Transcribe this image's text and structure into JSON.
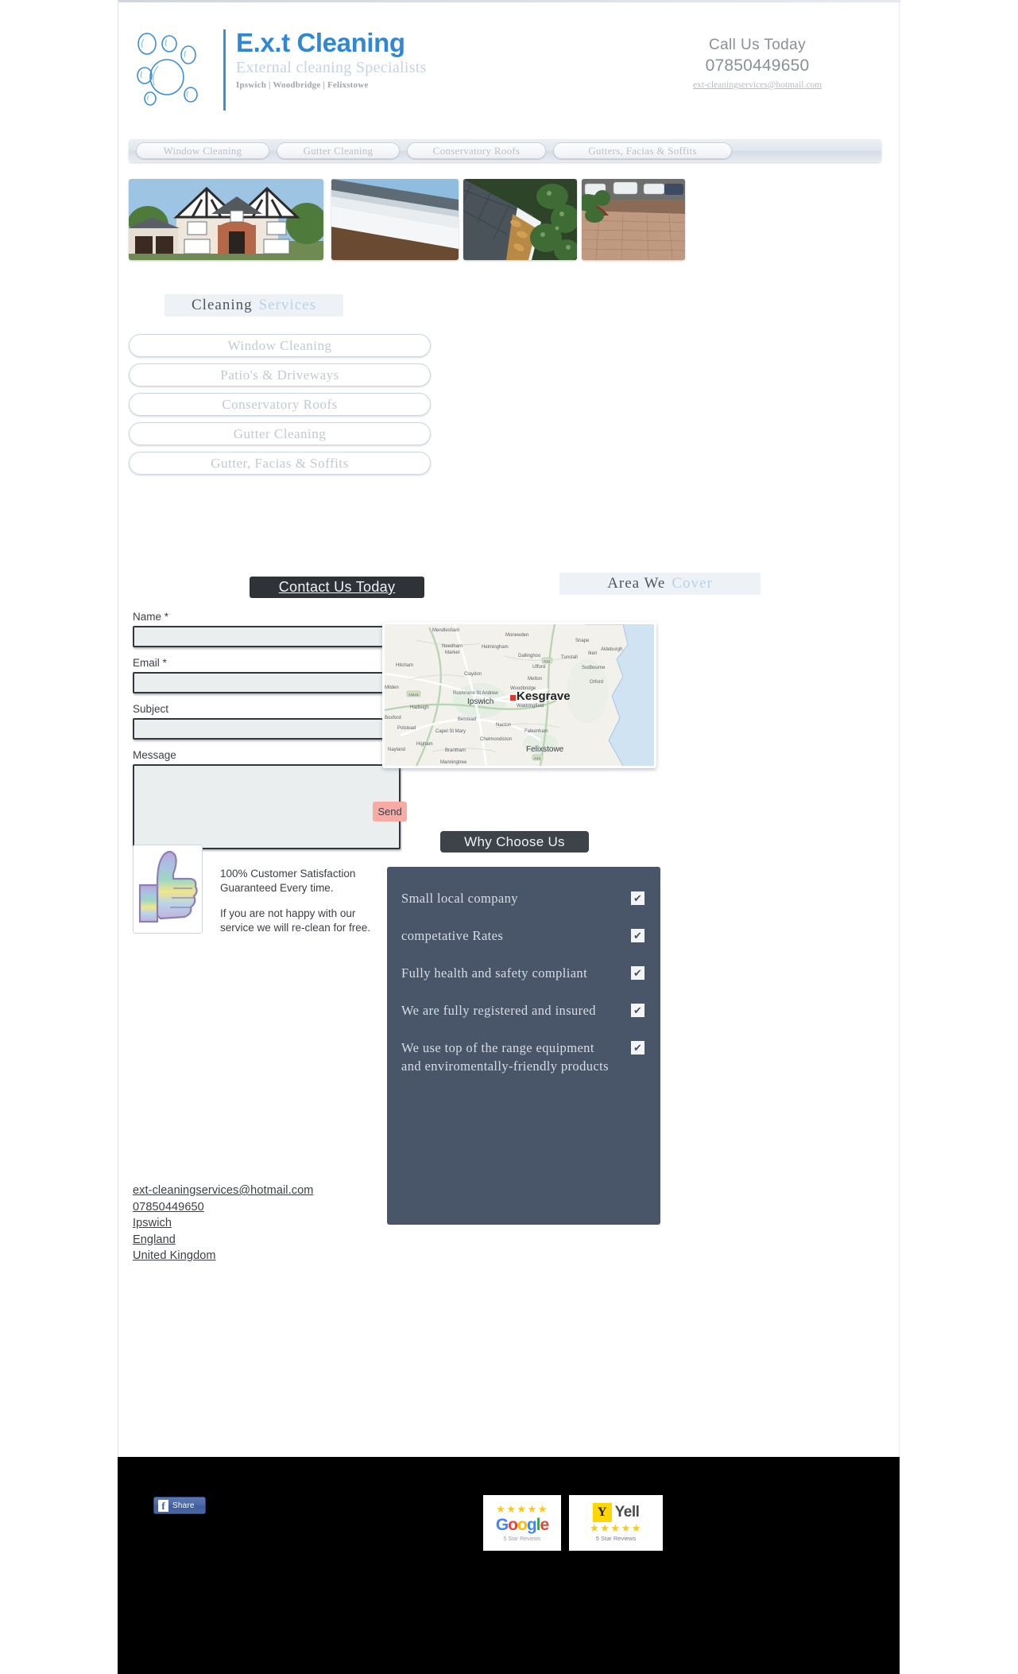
{
  "header": {
    "logo_title": "E.x.t Cleaning",
    "logo_subtitle": "External cleaning Specialists",
    "logo_places": "Ipswich | Woodbridge | Felixstowe",
    "call_title": "Call Us Today",
    "call_number": "07850449650",
    "call_email": "ext-cleaningservices@hotmail.com"
  },
  "nav": {
    "items": [
      {
        "label": "Window Cleaning"
      },
      {
        "label": "Gutter Cleaning"
      },
      {
        "label": "Conservatory Roofs"
      },
      {
        "label": "Gutters, Facias & Soffits"
      }
    ]
  },
  "photos": [
    {
      "alt": "tudor-style-house"
    },
    {
      "alt": "white-soffit-fascia"
    },
    {
      "alt": "leaf-filled-gutter"
    },
    {
      "alt": "block-paved-driveway"
    }
  ],
  "services": {
    "heading_dark": "Cleaning",
    "heading_light": "Services",
    "items": [
      {
        "label": "Window Cleaning"
      },
      {
        "label": "Patio's & Driveways"
      },
      {
        "label": "Conservatory Roofs"
      },
      {
        "label": "Gutter Cleaning"
      },
      {
        "label": "Gutter, Facias & Soffits"
      }
    ]
  },
  "contact": {
    "heading": "Contact Us Today",
    "name_label": "Name *",
    "name_value": "",
    "email_label": "Email *",
    "email_value": "",
    "subject_label": "Subject",
    "subject_value": "",
    "message_label": "Message",
    "message_value": "",
    "send_label": "Send"
  },
  "guarantee": {
    "line1": "100% Customer Satisfaction",
    "line2": "Guaranteed Every time.",
    "line3": "If you are not happy with our",
    "line4": "service we will re-clean for free.",
    "icon": "thumbs-up-icon"
  },
  "area": {
    "heading_dark": "Area We",
    "heading_light": "Cover",
    "map": {
      "marker_city": "Kesgrave",
      "major_labels": [
        "Ipswich",
        "Woodbridge",
        "Felixstowe"
      ],
      "minor_labels": [
        "Mendlesham",
        "Monewden",
        "Snape",
        "Needham Market",
        "Helmingham",
        "Dallinghoo",
        "Tunstall",
        "Iken",
        "Aldeburgh",
        "Hitcham",
        "Ufford",
        "Sudbourne",
        "Claydon",
        "Melton",
        "Orford",
        "Milden",
        "Rushmere St Andrew",
        "Waldringfield",
        "Hadleigh",
        "Boxford",
        "Belstead",
        "Nacton",
        "Polstead",
        "Capel St Mary",
        "Falkenham",
        "Chelmondiston",
        "Higham",
        "Nayland",
        "Brantham",
        "Manningtree"
      ],
      "road_labels": [
        "A12",
        "A1141",
        "A14"
      ]
    }
  },
  "why": {
    "heading": "Why Choose Us",
    "check_glyph": "✔",
    "items": [
      {
        "text": "Small local company"
      },
      {
        "text": "competative Rates"
      },
      {
        "text": "Fully health and safety compliant"
      },
      {
        "text": "We are fully registered and insured"
      },
      {
        "text": "We use top of the range equipment and enviromentally-friendly products"
      }
    ]
  },
  "footer_links": [
    {
      "label": "ext-cleaningservices@hotmail.com"
    },
    {
      "label": "07850449650"
    },
    {
      "label": "Ipswich"
    },
    {
      "label": "England"
    },
    {
      "label": "United Kingdom"
    }
  ],
  "footer_bar": {
    "facebook_glyph": "f",
    "facebook_label": "Share",
    "google_badge": {
      "stars": "★★★★★",
      "g": "G",
      "o1": "o",
      "o2": "o",
      "g2": "g",
      "l": "l",
      "e": "e",
      "reviews_label": "5 Star Reviews"
    },
    "yell_badge": {
      "mark": "Y",
      "word": "Yell",
      "stars": "★★★★★",
      "reviews_label": "5 Star Reviews"
    }
  },
  "colors": {
    "brand_blue": "#2f87d8",
    "accent_light_blue": "#b9d2ea",
    "panel_dark": "#49566a",
    "header_dark": "#2f3338",
    "send_button": "#f7aba4",
    "footer_black": "#000000"
  }
}
